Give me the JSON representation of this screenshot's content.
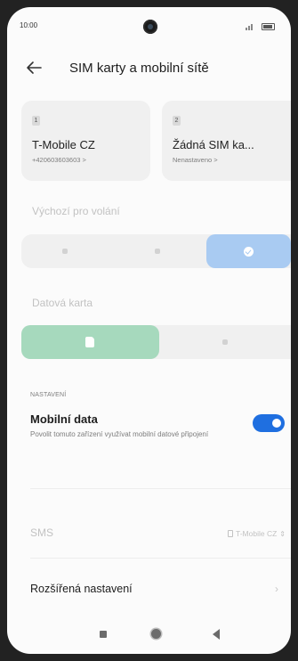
{
  "status": {
    "time": "10:00"
  },
  "header": {
    "title": "SIM karty a mobilní sítě"
  },
  "sims": [
    {
      "slot": "1",
      "name": "T-Mobile CZ",
      "number": "+420603603603 >"
    },
    {
      "slot": "2",
      "name": "Žádná SIM ka...",
      "status": "Nenastaveno >"
    }
  ],
  "default_calls": {
    "label": "Výchozí pro volání",
    "options": [
      "1",
      "2",
      "ask"
    ],
    "selected_index": 2
  },
  "data_card": {
    "label": "Datová karta",
    "options": [
      "1",
      "2"
    ],
    "selected_index": 0
  },
  "settings": {
    "heading": "NASTAVENÍ",
    "mobile_data": {
      "title": "Mobilní data",
      "description": "Povolit tomuto zařízení využívat mobilní datové připojení",
      "enabled": true
    }
  },
  "sms": {
    "label": "SMS",
    "value": "T-Mobile CZ"
  },
  "advanced": {
    "label": "Rozšířená nastavení"
  },
  "colors": {
    "toggle_on": "#1f6fe0",
    "calls_selected": "#a9cbf2",
    "data_selected": "#a6d9bd"
  }
}
